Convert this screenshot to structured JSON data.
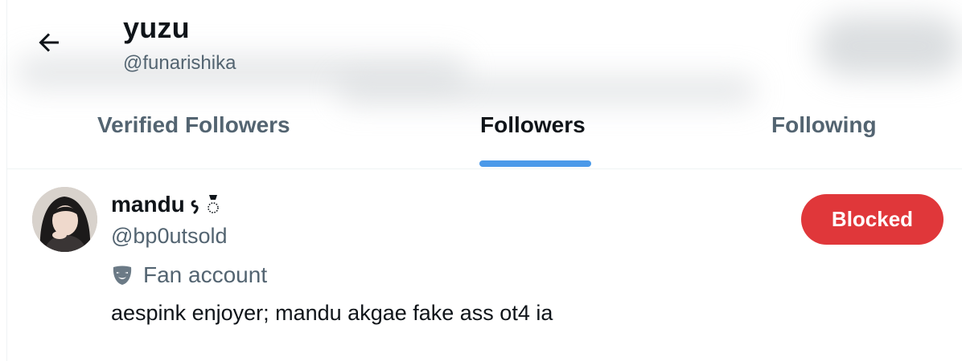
{
  "header": {
    "back_icon": "arrow-left-icon",
    "name": "yuzu",
    "handle": "@funarishika"
  },
  "tabs": [
    {
      "label": "Verified Followers",
      "active": false
    },
    {
      "label": "Followers",
      "active": true
    },
    {
      "label": "Following",
      "active": false
    }
  ],
  "follower": {
    "name": "mandu",
    "name_emoji": "ʙᶑ",
    "handle": "@bp0utsold",
    "label_icon": "theater-mask-icon",
    "label": "Fan account",
    "bio": "aespink enjoyer; mandu akgae fake ass ot4 ia",
    "button": "Blocked"
  },
  "colors": {
    "accent": "#4a99e9",
    "blocked": "#e0373a",
    "text_primary": "#0f1419",
    "text_secondary": "#536471"
  }
}
